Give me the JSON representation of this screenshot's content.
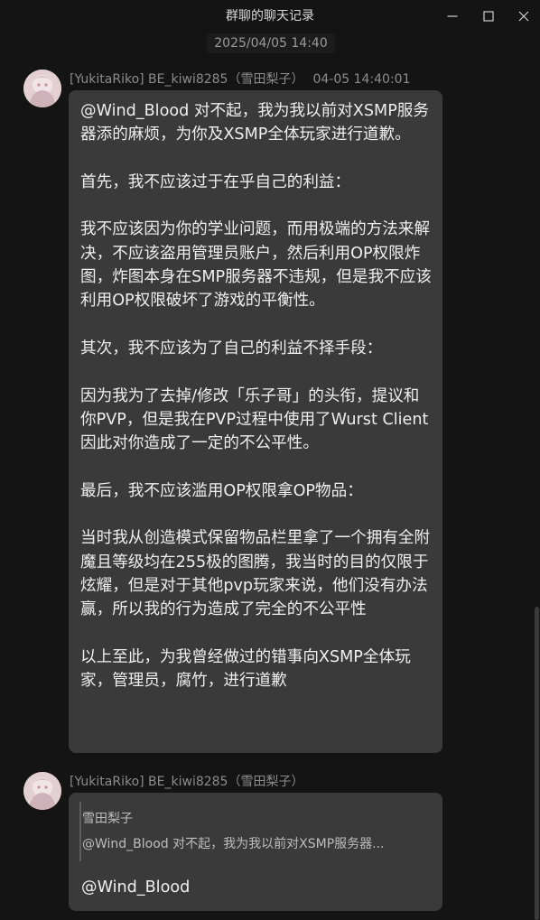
{
  "window": {
    "title": "群聊的聊天记录",
    "controls": {
      "minimize_icon": "minimize-icon",
      "maximize_icon": "maximize-icon",
      "close_icon": "close-icon"
    }
  },
  "date_separator": "2025/04/05 14:40",
  "messages": [
    {
      "sender": "[YukitaRiko] BE_kiwi8285（雪田梨子）",
      "time": "04-05 14:40:01",
      "paragraphs": [
        "@Wind_Blood 对不起，我为我以前对XSMP服务器添的麻烦，为你及XSMP全体玩家进行道歉。",
        "首先，我不应该过于在乎自己的利益：",
        "我不应该因为你的学业问题，而用极端的方法来解决，不应该盗用管理员账户，然后利用OP权限炸图，炸图本身在SMP服务器不违规，但是我不应该利用OP权限破坏了游戏的平衡性。",
        "其次，我不应该为了自己的利益不择手段：",
        "因为我为了去掉/修改「乐子哥」的头衔，提议和你PVP，但是我在PVP过程中使用了Wurst Client因此对你造成了一定的不公平性。",
        "最后，我不应该滥用OP权限拿OP物品：",
        "当时我从创造模式保留物品栏里拿了一个拥有全附魔且等级均在255极的图腾，我当时的目的仅限于炫耀，但是对于其他pvp玩家来说，他们没有办法赢，所以我的行为造成了完全的不公平性",
        "以上至此，为我曾经做过的错事向XSMP全体玩家，管理员，腐竹，进行道歉"
      ]
    },
    {
      "sender": "[YukitaRiko] BE_kiwi8285（雪田梨子）",
      "quote": {
        "name": "雪田梨子",
        "text": "@Wind_Blood 对不起，我为我以前对XSMP服务器..."
      },
      "text": "@Wind_Blood"
    }
  ],
  "colors": {
    "background": "#141414",
    "bubble": "#3a3a3a",
    "text": "#efefef",
    "muted": "#8c8c8c"
  }
}
